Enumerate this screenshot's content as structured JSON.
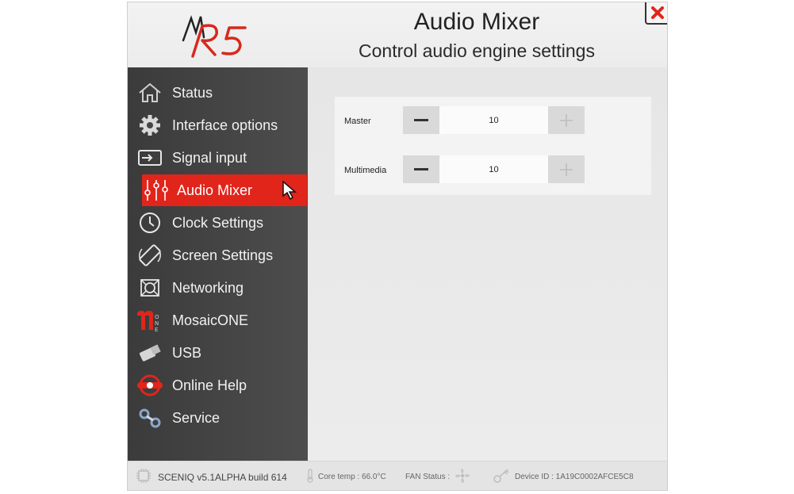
{
  "header": {
    "logo_text": "R5",
    "logo_mark": "M",
    "title": "Audio Mixer",
    "subtitle": "Control audio engine settings",
    "close_icon": "close-icon"
  },
  "sidebar": {
    "items": [
      {
        "label": "Status",
        "icon": "home-icon"
      },
      {
        "label": "Interface options",
        "icon": "gear-icon"
      },
      {
        "label": "Signal input",
        "icon": "input-icon"
      },
      {
        "label": "Audio Mixer",
        "icon": "sliders-icon"
      },
      {
        "label": "Clock Settings",
        "icon": "clock-icon"
      },
      {
        "label": "Screen Settings",
        "icon": "rotate-screen-icon"
      },
      {
        "label": "Networking",
        "icon": "network-icon"
      },
      {
        "label": "MosaicONE",
        "icon": "mosaic-icon"
      },
      {
        "label": "USB",
        "icon": "usb-icon"
      },
      {
        "label": "Online Help",
        "icon": "help-icon"
      },
      {
        "label": "Service",
        "icon": "service-icon"
      }
    ],
    "active_index": 3,
    "accent_color": "#e1251b"
  },
  "mixer": {
    "channels": [
      {
        "label": "Master",
        "value": "10"
      },
      {
        "label": "Multimedia",
        "value": "10"
      }
    ],
    "minus_symbol": "—",
    "plus_symbol": "+"
  },
  "footer": {
    "build": "SCENIQ v5.1ALPHA build 614",
    "core_temp": "Core temp : 66.0°C",
    "fan_status": "FAN Status :",
    "device_id": "Device ID : 1A19C0002AFCE5C8"
  }
}
